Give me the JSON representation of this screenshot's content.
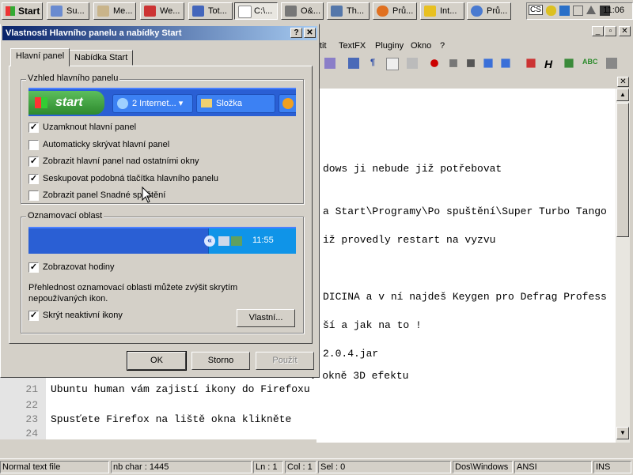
{
  "taskbar": {
    "start_label": "Start",
    "buttons": [
      "Su...",
      "Me...",
      "We...",
      "Tot...",
      "C:\\...",
      "O&...",
      "Th...",
      "Prů...",
      "Int...",
      "Prů..."
    ],
    "tray_label": "CS",
    "clock": "11:06"
  },
  "npp": {
    "menu": [
      "tit",
      "TextFX",
      "Pluginy",
      "Okno",
      "?"
    ],
    "editor_lines": [
      "dows ji nebude již potřebovat",
      "a Start\\Programy\\Po spuštění\\Super Turbo Tango",
      "iž provedly restart na vyzvu",
      "DICINA a v ní najdeš Keygen pro Defrag Profess",
      "ší a jak na to !",
      "2.0.4.jar"
    ],
    "lower_lines": [
      {
        "num": "21",
        "text": "Ubuntu human vám zajistí ikony do Firefoxu"
      },
      {
        "num": "22",
        "text": ""
      },
      {
        "num": "23",
        "text": "Spusťete Firefox na liště okna klikněte"
      },
      {
        "num": "24",
        "text": ""
      }
    ],
    "partial_line": "v okně 3D efektu",
    "status": {
      "type": "Normal text file",
      "chars": "nb char : 1445",
      "ln": "Ln : 1",
      "col": "Col : 1",
      "sel": "Sel : 0",
      "eol": "Dos\\Windows",
      "enc": "ANSI",
      "ins": "INS"
    }
  },
  "dialog": {
    "title": "Vlastnosti Hlavního panelu a nabídky Start",
    "help": "?",
    "close": "✕",
    "tabs": [
      "Hlavní panel",
      "Nabídka Start"
    ],
    "group1": {
      "legend": "Vzhled hlavního panelu",
      "preview": {
        "start": "start",
        "btn1": "2 Internet...",
        "btn2": "Složka"
      },
      "options": [
        {
          "label": "Uzamknout hlavní panel",
          "checked": true
        },
        {
          "label": "Automaticky skrývat hlavní panel",
          "checked": false
        },
        {
          "label": "Zobrazit hlavní panel nad ostatními okny",
          "checked": true
        },
        {
          "label": "Seskupovat podobná tlačítka hlavního panelu",
          "checked": true
        },
        {
          "label": "Zobrazit panel Snadné spuštění",
          "checked": false
        }
      ]
    },
    "group2": {
      "legend": "Oznamovací oblast",
      "preview_clock": "11:55",
      "show_clock": {
        "label": "Zobrazovat hodiny",
        "checked": true
      },
      "info": "Přehlednost oznamovací oblasti můžete zvýšit skrytím nepoužívaných ikon.",
      "hide_inactive": {
        "label": "Skrýt neaktivní ikony",
        "checked": true
      },
      "customize": "Vlastní..."
    },
    "buttons": {
      "ok": "OK",
      "cancel": "Storno",
      "apply": "Použít"
    }
  },
  "colors": {
    "title_start": "#0a246a",
    "title_end": "#a6caf0",
    "xp_blue": "#2a5fd4",
    "xp_green": "#3aa53a"
  }
}
